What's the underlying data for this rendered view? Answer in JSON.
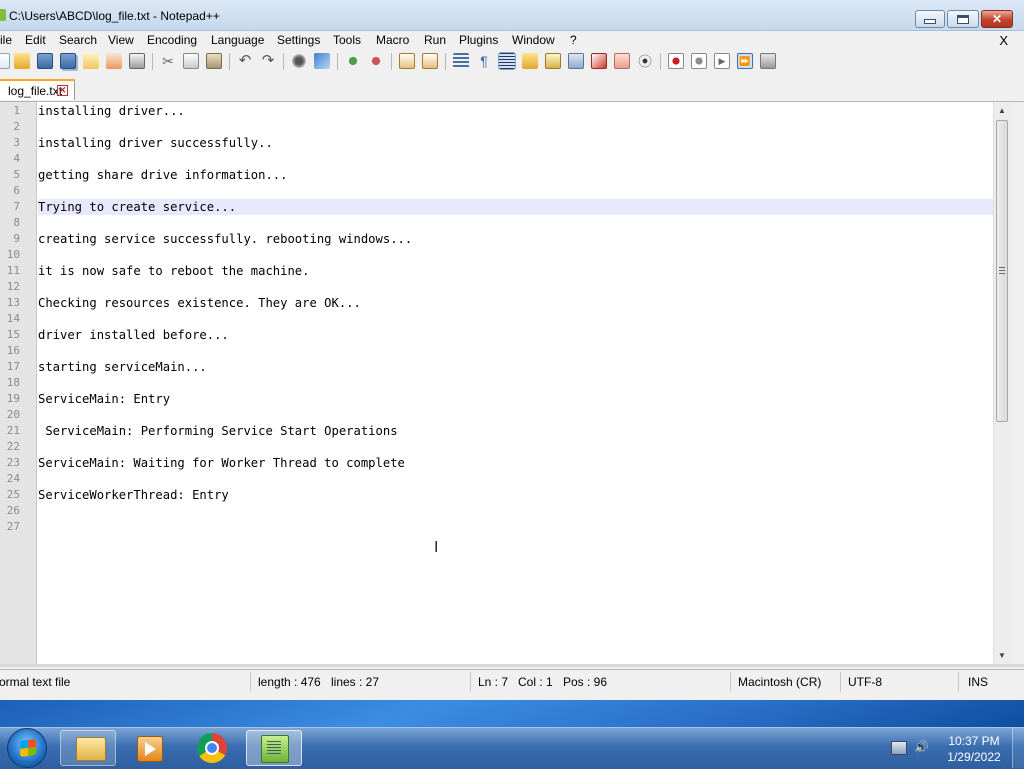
{
  "window": {
    "title": "C:\\Users\\ABCD\\log_file.txt - Notepad++",
    "icon": "notepad-plus-plus-icon"
  },
  "menu": {
    "items": [
      "ile",
      "Edit",
      "Search",
      "View",
      "Encoding",
      "Language",
      "Settings",
      "Tools",
      "Macro",
      "Run",
      "Plugins",
      "Window",
      "?"
    ],
    "close_label": "X"
  },
  "toolbar": {
    "icons": [
      "new-file-icon",
      "open-file-icon",
      "save-icon",
      "save-all-icon",
      "close-icon",
      "close-all-icon",
      "print-icon",
      "cut-icon",
      "copy-icon",
      "paste-icon",
      "undo-icon",
      "redo-icon",
      "find-icon",
      "replace-icon",
      "zoom-in-icon",
      "zoom-out-icon",
      "sync-vertical-icon",
      "sync-horizontal-icon",
      "word-wrap-icon",
      "show-all-characters-icon",
      "indent-guide-icon",
      "user-language-icon",
      "doc-map-icon",
      "function-list-icon",
      "folder-as-workspace-icon",
      "document-list-icon",
      "monitoring-icon",
      "record-macro-icon",
      "stop-macro-icon",
      "play-macro-icon",
      "run-macro-multiple-icon",
      "save-macro-icon"
    ]
  },
  "tab": {
    "label": "log_file.txt"
  },
  "editor": {
    "current_line": 7,
    "lines": [
      "installing driver...",
      "",
      "installing driver successfully..",
      "",
      "getting share drive information...",
      "",
      "Trying to create service...",
      "",
      "creating service successfully. rebooting windows...",
      "",
      "it is now safe to reboot the machine.",
      "",
      "Checking resources existence. They are OK...",
      "",
      "driver installed before...",
      "",
      "starting serviceMain...",
      "",
      "ServiceMain: Entry",
      "",
      " ServiceMain: Performing Service Start Operations",
      "",
      "ServiceMain: Waiting for Worker Thread to complete",
      "",
      "ServiceWorkerThread: Entry",
      "",
      ""
    ]
  },
  "status": {
    "file_type": "ormal text file",
    "length": "length : 476",
    "lines": "lines : 27",
    "ln": "Ln : 7",
    "col": "Col : 1",
    "pos": "Pos : 96",
    "eol": "Macintosh (CR)",
    "encoding": "UTF-8",
    "mode": "INS"
  },
  "taskbar": {
    "apps": [
      "windows-explorer-icon",
      "media-player-icon",
      "chrome-icon",
      "notepad-plus-plus-icon"
    ],
    "time": "10:37 PM",
    "date": "1/29/2022",
    "tray_icons": [
      "network-icon",
      "volume-icon"
    ]
  },
  "colors": {
    "current_line_bg": "#e8e8ff",
    "tab_accent": "#f5a623",
    "taskbar": "#3a6db0"
  }
}
